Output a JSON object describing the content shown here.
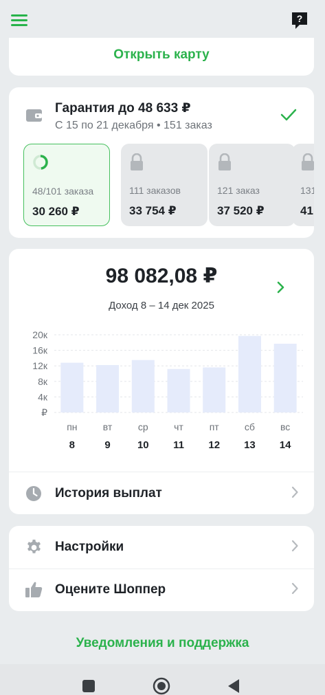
{
  "top_bar": {
    "menu_icon": "hamburger-icon",
    "help_icon": "question-chat-icon"
  },
  "map_card": {
    "open_map": "Открыть карту"
  },
  "guarantee": {
    "title": "Гарантия до 48 633 ₽",
    "subtitle": "С 15 по 21 декабря • 151 заказ",
    "status_icon": "checkmark-icon",
    "tiers": [
      {
        "count": "48/101 заказа",
        "amount": "30 260 ₽",
        "state": "in-progress",
        "progress": 0.48
      },
      {
        "count": "111 заказов",
        "amount": "33 754 ₽",
        "state": "locked"
      },
      {
        "count": "121 заказ",
        "amount": "37 520 ₽",
        "state": "locked"
      },
      {
        "count": "131",
        "amount": "41",
        "state": "locked"
      }
    ]
  },
  "income": {
    "amount": "98 082,08 ₽",
    "period": "Доход 8 – 14 дек 2025"
  },
  "chart_data": {
    "type": "bar",
    "y_ticks": [
      "20к",
      "16к",
      "12к",
      "8к",
      "4к",
      "₽"
    ],
    "ylim": [
      0,
      20000
    ],
    "categories": [
      "пн",
      "вт",
      "ср",
      "чт",
      "пт",
      "сб",
      "вс"
    ],
    "dates": [
      "8",
      "9",
      "10",
      "11",
      "12",
      "13",
      "14"
    ],
    "values": [
      12800,
      12200,
      13500,
      11200,
      11600,
      19700,
      17700
    ],
    "bar_color": "#e5ebfb",
    "grid": true
  },
  "history": {
    "label": "История выплат",
    "icon": "clock-icon"
  },
  "settings": {
    "label": "Настройки",
    "icon": "gear-icon"
  },
  "rate": {
    "label": "Оцените Шоппер",
    "icon": "thumbs-up-icon"
  },
  "support": {
    "label": "Уведомления и поддержка"
  },
  "colors": {
    "accent": "#2bb24c",
    "background": "#e9ecee",
    "card": "#ffffff"
  }
}
